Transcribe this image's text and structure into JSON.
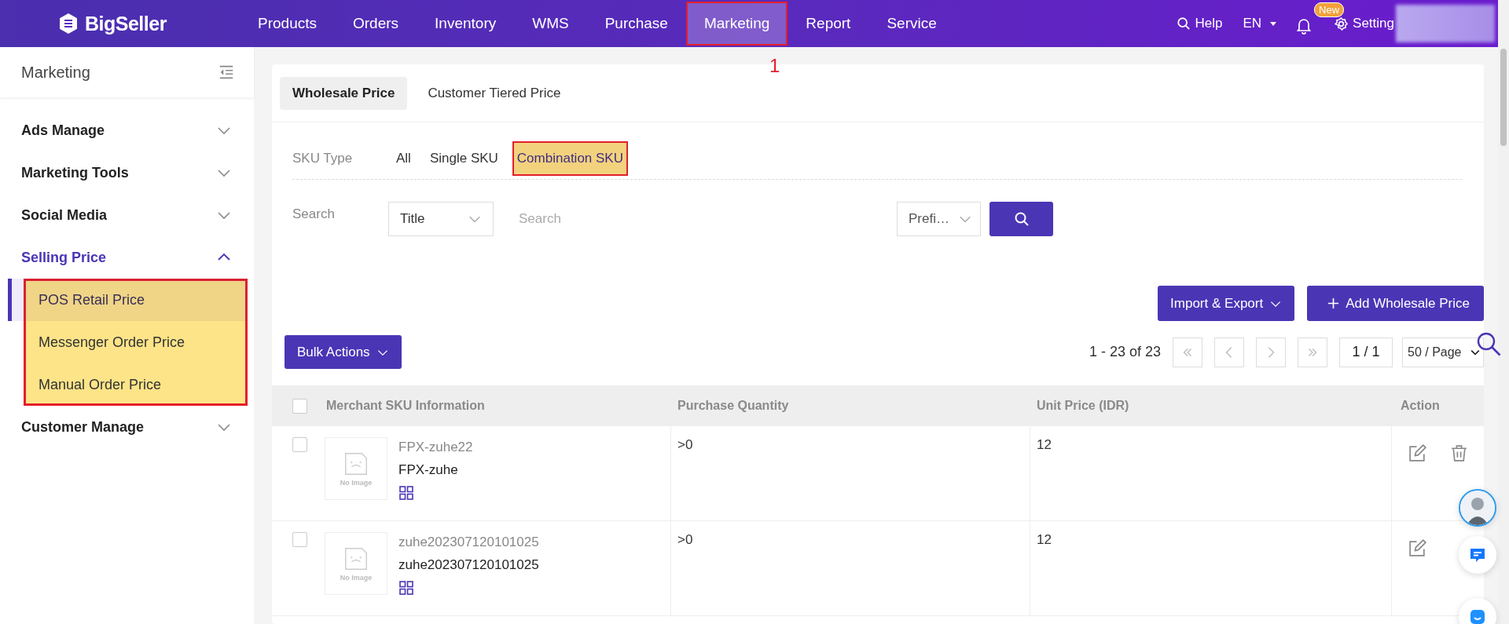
{
  "header": {
    "logo": "BigSeller",
    "nav": [
      {
        "label": "Products",
        "selected": false,
        "highlighted": false
      },
      {
        "label": "Orders",
        "selected": false,
        "highlighted": false
      },
      {
        "label": "Inventory",
        "selected": false,
        "highlighted": false
      },
      {
        "label": "WMS",
        "selected": false,
        "highlighted": false
      },
      {
        "label": "Purchase",
        "selected": false,
        "highlighted": false
      },
      {
        "label": "Marketing",
        "selected": true,
        "highlighted": true
      },
      {
        "label": "Report",
        "selected": false,
        "highlighted": false
      },
      {
        "label": "Service",
        "selected": false,
        "highlighted": false
      }
    ],
    "help": "Help",
    "language": "EN",
    "badge": "New",
    "setting": "Setting"
  },
  "annotation": {
    "marker": "1"
  },
  "sidebar": {
    "title": "Marketing",
    "items": [
      {
        "label": "Ads Manage",
        "selected": false,
        "expanded": false
      },
      {
        "label": "Marketing Tools",
        "selected": false,
        "expanded": false
      },
      {
        "label": "Social Media",
        "selected": false,
        "expanded": false
      },
      {
        "label": "Selling Price",
        "selected": true,
        "expanded": true,
        "highlighted": true,
        "children": [
          {
            "label": "POS Retail Price",
            "selected": true
          },
          {
            "label": "Messenger Order Price",
            "selected": false
          },
          {
            "label": "Manual Order Price",
            "selected": false
          }
        ]
      },
      {
        "label": "Customer Manage",
        "selected": false,
        "expanded": false
      }
    ]
  },
  "tabs": [
    {
      "label": "Wholesale Price",
      "selected": true
    },
    {
      "label": "Customer Tiered Price",
      "selected": false
    }
  ],
  "filters": {
    "sku_type_label": "SKU Type",
    "sku_types": [
      {
        "label": "All",
        "selected": false,
        "highlighted": false
      },
      {
        "label": "Single SKU",
        "selected": false,
        "highlighted": false
      },
      {
        "label": "Combination SKU",
        "selected": true,
        "highlighted": true
      }
    ],
    "search_label": "Search",
    "search_by": "Title",
    "search_placeholder": "Search",
    "match_mode": "Prefi…"
  },
  "toolbar": {
    "import_export": "Import & Export",
    "add": "Add Wholesale Price",
    "bulk_actions": "Bulk Actions"
  },
  "pagination": {
    "summary": "1 - 23 of 23",
    "page": "1 / 1",
    "page_size": "50 / Page"
  },
  "table": {
    "header_checked": false,
    "columns": [
      "Merchant SKU Information",
      "Purchase Quantity",
      "Unit Price (IDR)",
      "Action"
    ],
    "rows": [
      {
        "checked": false,
        "title": "FPX-zuhe22",
        "sku": "FPX-zuhe",
        "image": "No Image",
        "quantity": ">0",
        "unit_price": "12",
        "actions": [
          {
            "kind": "edit"
          },
          {
            "kind": "delete"
          }
        ]
      },
      {
        "checked": false,
        "title": "zuhe202307120101025",
        "sku": "zuhe202307120101025",
        "image": "No Image",
        "quantity": ">0",
        "unit_price": "12",
        "actions": [
          {
            "kind": "edit"
          }
        ]
      }
    ]
  }
}
